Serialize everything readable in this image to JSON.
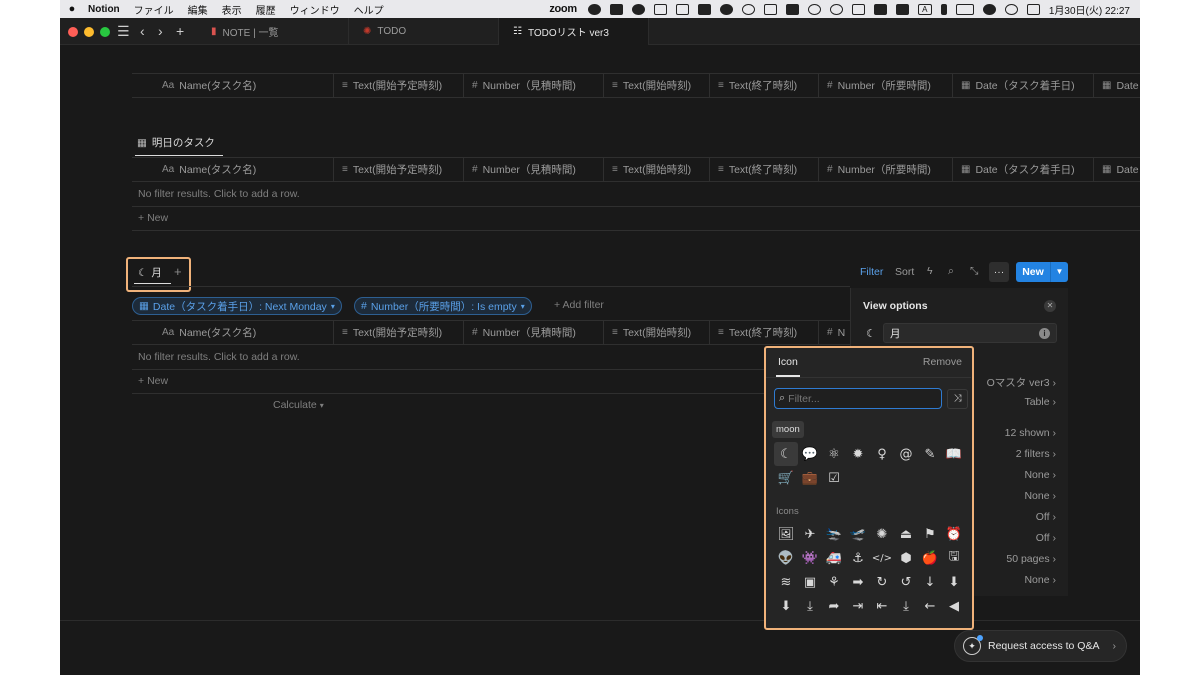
{
  "menubar": {
    "app_name": "Notion",
    "items": [
      "ファイル",
      "編集",
      "表示",
      "履歴",
      "ウィンドウ",
      "ヘルプ"
    ],
    "zoom_label": "zoom",
    "clock": "1月30日(火)  22:27",
    "input_indicator": "A"
  },
  "tabs": [
    {
      "label": "NOTE | 一覧",
      "icon": "book-icon"
    },
    {
      "label": "TODO",
      "icon": "gear-icon"
    },
    {
      "label": "TODOリスト ver3",
      "icon": "checklist-icon"
    }
  ],
  "columns": [
    {
      "icon": "Aa",
      "label": "Name(タスク名)"
    },
    {
      "icon": "≡",
      "label": "Text(開始予定時刻)"
    },
    {
      "icon": "#",
      "label": "Number（見積時間)"
    },
    {
      "icon": "≡",
      "label": "Text(開始時刻)"
    },
    {
      "icon": "≡",
      "label": "Text(終了時刻)"
    },
    {
      "icon": "#",
      "label": "Number（所要時間)"
    },
    {
      "icon": "▦",
      "label": "Date（タスク着手日)"
    },
    {
      "icon": "▦",
      "label": "Date"
    }
  ],
  "view2": {
    "title": "明日のタスク",
    "empty_hint": "No filter results. Click to add a row.",
    "new_label": "New"
  },
  "view3": {
    "tab_label": "月",
    "tab_plus": "+",
    "toolbar": {
      "filter": "Filter",
      "sort": "Sort",
      "more": "···",
      "new": "New"
    },
    "filters": [
      "Date（タスク着手日）: Next Monday",
      "Number（所要時間）: Is empty"
    ],
    "add_filter": "+ Add filter",
    "partial_column": "N",
    "empty_hint": "No filter results. Click to add a row.",
    "new_label": "New",
    "calculate": "Calculate"
  },
  "view_options": {
    "title": "View options",
    "name_value": "月",
    "rows": [
      "Oマスタ ver3",
      "Table",
      "12 shown",
      "2 filters",
      "None",
      "None",
      "Off",
      "Off",
      "50 pages",
      "None"
    ]
  },
  "icon_picker": {
    "tab": "Icon",
    "remove": "Remove",
    "placeholder": "Filter...",
    "tooltip": "moon",
    "icons_section": "Icons",
    "recent": [
      "☾",
      "💬",
      "⚛",
      "✹",
      "♀",
      "@",
      "✎",
      "📖",
      "🛒",
      "💼",
      "☑"
    ],
    "icons": [
      "🖼",
      "✈",
      "🛬",
      "🛫",
      "✺",
      "⏏",
      "⚑",
      "⏰",
      "👽",
      "👾",
      "🚑",
      "⚓",
      "</>",
      "⬢",
      "🍎",
      "🖫",
      "≋",
      "▣",
      "⚘",
      "➡",
      "↻",
      "↺",
      "↓",
      "⬇",
      "⬇",
      "⤓",
      "➦",
      "⇥",
      "⇤",
      "⤓",
      "←",
      "◀"
    ],
    "accent": "#2f7bd1"
  },
  "qa_button": "Request access to Q&A",
  "colors": {
    "highlight": "#f0b27a",
    "primary": "#2383e2",
    "background": "#191919"
  }
}
